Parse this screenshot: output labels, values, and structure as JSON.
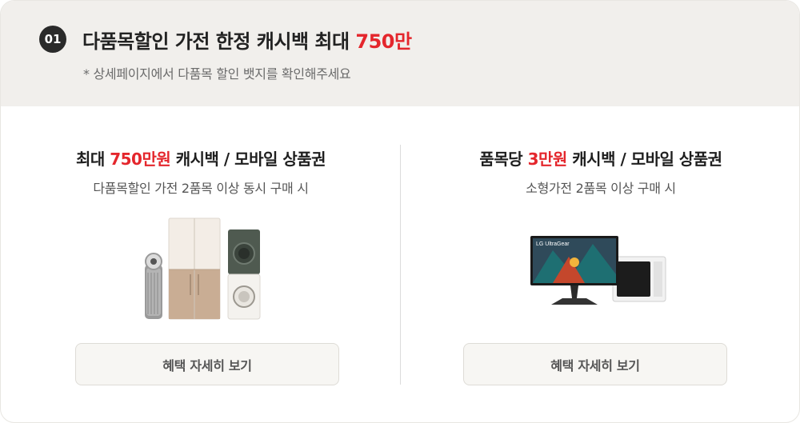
{
  "header": {
    "step_number": "01",
    "title_main": "다품목할인 가전 한정 캐시백 최대 ",
    "title_accent": "750만",
    "subtitle": "* 상세페이지에서 다품목 할인 뱃지를 확인해주세요"
  },
  "panels": [
    {
      "title_prefix": "최대 ",
      "title_accent": "750만원",
      "title_suffix": " 캐시백 / 모바일 상품권",
      "description": "다품목할인 가전 2품목 이상 동시 구매 시",
      "button_label": "혜택 자세히 보기",
      "image": "home-appliances-set"
    },
    {
      "title_prefix": "품목당 ",
      "title_accent": "3만원",
      "title_suffix": " 캐시백 / 모바일 상품권",
      "description": "소형가전 2품목 이상 구매 시",
      "button_label": "혜택 자세히 보기",
      "image": "monitor-and-microwave",
      "monitor_brand_text": "LG UltraGear"
    }
  ],
  "colors": {
    "accent": "#e4262c",
    "header_bg": "#f1efec",
    "button_bg": "#f7f6f3"
  }
}
